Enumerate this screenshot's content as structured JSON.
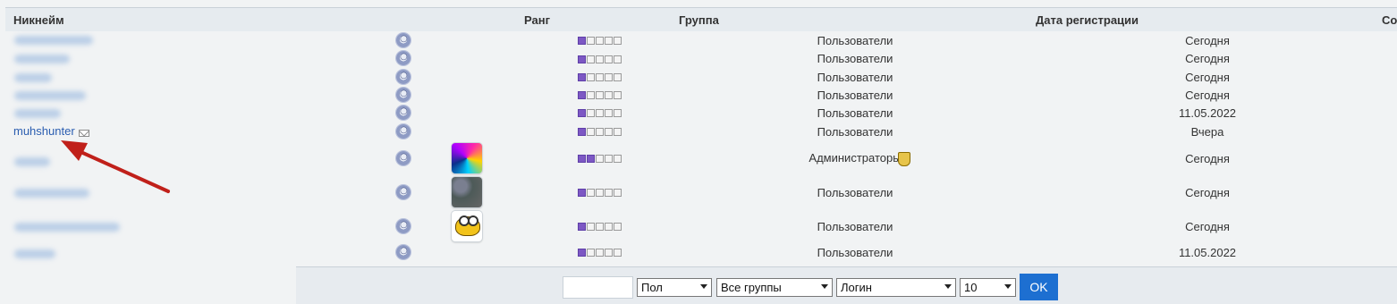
{
  "header": {
    "nickname": "Никнейм",
    "rank": "Ранг",
    "group": "Группа",
    "registration": "Дата регистрации",
    "last_col": "Co"
  },
  "rows": [
    {
      "nickname": "",
      "group": "Пользователи",
      "date": "Сегодня",
      "rank": 1,
      "avatar": ""
    },
    {
      "nickname": "",
      "group": "Пользователи",
      "date": "Сегодня",
      "rank": 1,
      "avatar": ""
    },
    {
      "nickname": "",
      "group": "Пользователи",
      "date": "Сегодня",
      "rank": 1,
      "avatar": ""
    },
    {
      "nickname": "",
      "group": "Пользователи",
      "date": "Сегодня",
      "rank": 1,
      "avatar": ""
    },
    {
      "nickname": "",
      "group": "Пользователи",
      "date": "11.05.2022",
      "rank": 1,
      "avatar": ""
    },
    {
      "nickname": "muhshunter",
      "group": "Пользователи",
      "date": "Вчера",
      "rank": 1,
      "avatar": ""
    },
    {
      "nickname": "",
      "group": "Администраторы",
      "date": "Сегодня",
      "rank": 2,
      "avatar": "colorful-abstract"
    },
    {
      "nickname": "",
      "group": "Пользователи",
      "date": "Сегодня",
      "rank": 1,
      "avatar": "dark-texture"
    },
    {
      "nickname": "",
      "group": "Пользователи",
      "date": "Сегодня",
      "rank": 1,
      "avatar": "yellow-cartoon-glasses"
    },
    {
      "nickname": "",
      "group": "Пользователи",
      "date": "11.05.2022",
      "rank": 1,
      "avatar": ""
    }
  ],
  "footer": {
    "search_value": "",
    "gender": "Пол",
    "groups": "Все группы",
    "sort": "Логин",
    "per_page": "10",
    "ok": "OK"
  },
  "colors": {
    "arrow": "#c0201a",
    "link": "#2a5db0",
    "ok_button": "#1d6fd1",
    "rank_active": "#7d58c4"
  }
}
